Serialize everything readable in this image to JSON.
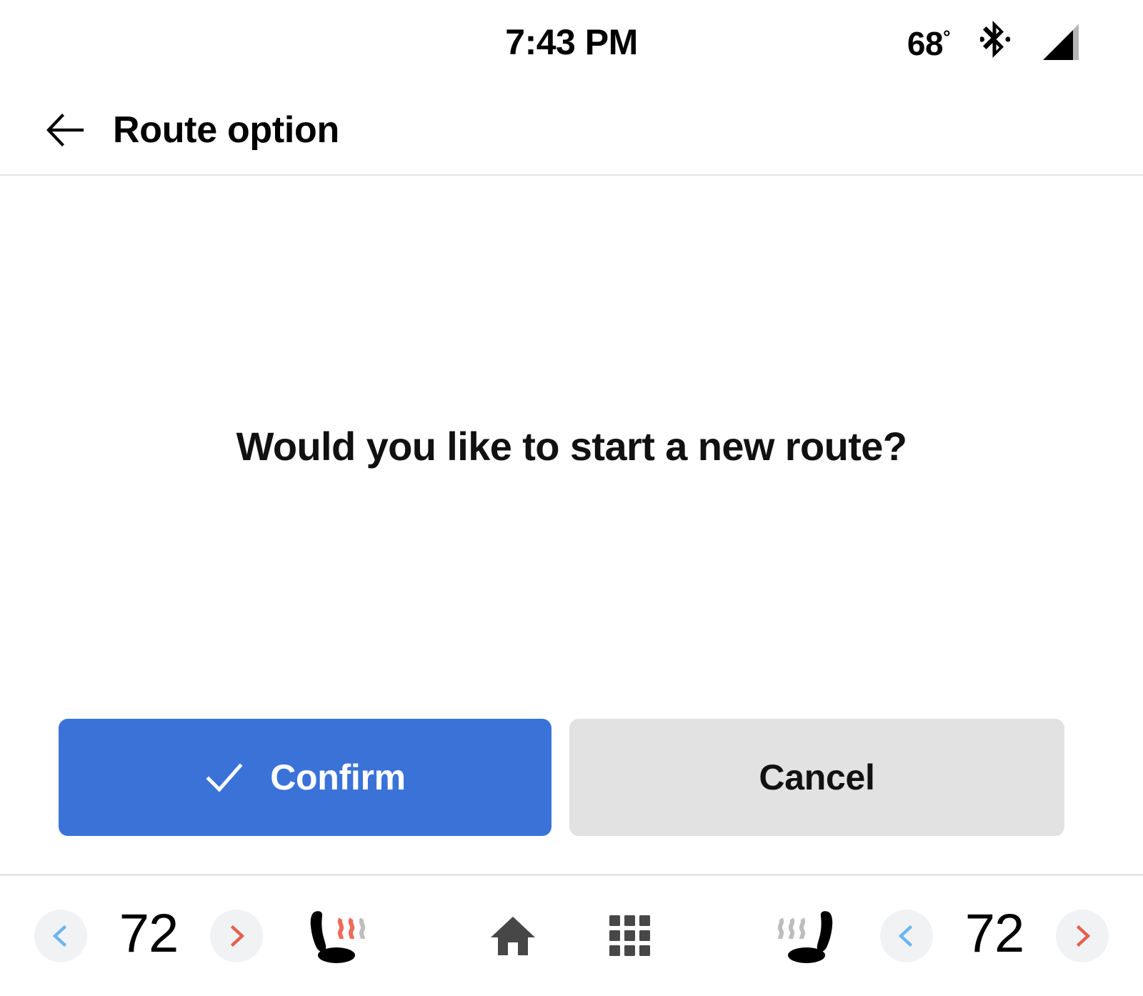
{
  "status_bar": {
    "clock": "7:43 PM",
    "temperature": "68",
    "degree_symbol": "°",
    "bluetooth_icon": "bluetooth-icon",
    "signal_icon": "cellular-signal-icon"
  },
  "header": {
    "back_icon": "back-arrow-icon",
    "title": "Route option"
  },
  "main": {
    "prompt": "Would you like to start a new route?",
    "confirm_label": "Confirm",
    "confirm_icon": "checkmark-icon",
    "cancel_label": "Cancel"
  },
  "nav_bar": {
    "left_climate": {
      "decrease_icon": "chevron-left-icon",
      "temperature": "72",
      "increase_icon": "chevron-right-icon",
      "seat_heater_icon": "heated-seat-icon",
      "seat_heater_level": 2,
      "seat_heater_max": 3
    },
    "center": {
      "home_icon": "home-icon",
      "apps_icon": "apps-grid-icon"
    },
    "right_climate": {
      "seat_heater_icon": "heated-seat-icon",
      "seat_heater_level": 0,
      "seat_heater_max": 3,
      "decrease_icon": "chevron-left-icon",
      "temperature": "72",
      "increase_icon": "chevron-right-icon"
    }
  },
  "colors": {
    "accent_blue": "#3A72D8",
    "chevron_cool_blue": "#6BB5F0",
    "chevron_warm_red": "#E2604F",
    "button_gray": "#E2E2E2",
    "circle_gray": "#F1F2F3",
    "divider_gray": "#E6E6E6",
    "heat_active_red": "#EF6A5A",
    "heat_inactive_gray": "#BDBDBD",
    "icon_dark": "#474747"
  }
}
